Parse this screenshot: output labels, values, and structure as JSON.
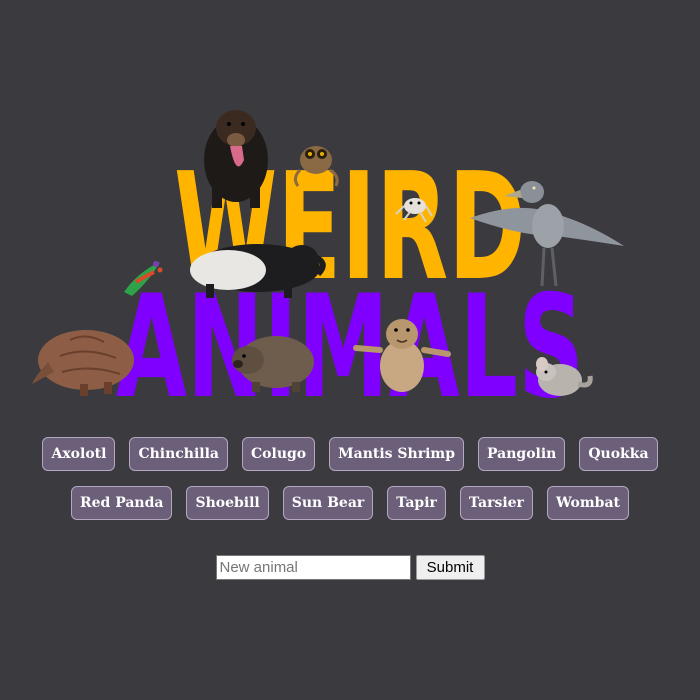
{
  "logo": {
    "line1": "WEIRD",
    "line2": "ANIMALS",
    "line1_color": "#ffb400",
    "line2_color": "#8000ff"
  },
  "animal_buttons": {
    "row1": [
      "Axolotl",
      "Chinchilla",
      "Colugo",
      "Mantis Shrimp",
      "Pangolin",
      "Quokka"
    ],
    "row2": [
      "Red Panda",
      "Shoebill",
      "Sun Bear",
      "Tapir",
      "Tarsier",
      "Wombat"
    ]
  },
  "form": {
    "placeholder": "New animal",
    "submit_label": "Submit"
  },
  "colors": {
    "background": "#3b3a3f",
    "button_bg": "#6c5f7a",
    "button_border": "#b4a7c2"
  }
}
